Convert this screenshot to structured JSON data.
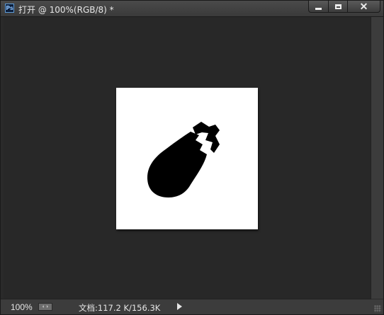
{
  "window": {
    "app_icon": "photoshop-icon",
    "app_icon_text": "Ps",
    "title": "打开 @ 100%(RGB/8) *",
    "buttons": {
      "minimize": "minimize-icon",
      "maximize": "maximize-icon",
      "close": "close-icon"
    }
  },
  "canvas": {
    "background": "#282828",
    "document_color": "#ffffff",
    "artwork": "eggplant-icon",
    "artwork_color": "#000000"
  },
  "statusbar": {
    "zoom": "100%",
    "document_info": "文档:117.2 K/156.3K"
  }
}
